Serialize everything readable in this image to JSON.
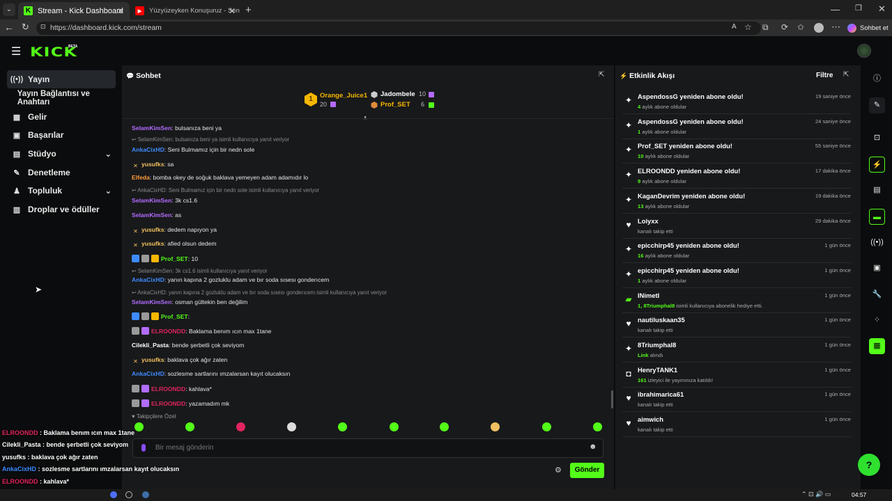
{
  "browser": {
    "tabs": [
      {
        "title": "Stream - Kick Dashboard",
        "active": true
      },
      {
        "title": "Yüzyüzeyken Konuşuruz - Sen",
        "active": false
      }
    ],
    "url": "https://dashboard.kick.com/stream",
    "profile_label": "Sohbet et"
  },
  "header": {
    "logo": "KICK",
    "logo_tag": "BETA"
  },
  "sidebar": {
    "items": [
      {
        "label": "Yayın",
        "icon": "broadcast-icon",
        "active": true
      },
      {
        "label": "Yayın Bağlantısı ve Anahtarı",
        "icon": "",
        "sub": true
      },
      {
        "label": "Gelir",
        "icon": "revenue-icon"
      },
      {
        "label": "Başarılar",
        "icon": "achievements-icon"
      },
      {
        "label": "Stüdyo",
        "icon": "studio-icon",
        "chevron": true
      },
      {
        "label": "Denetleme",
        "icon": "moderation-icon"
      },
      {
        "label": "Topluluk",
        "icon": "community-icon",
        "chevron": true
      },
      {
        "label": "Droplar ve ödüller",
        "icon": "drops-icon"
      }
    ]
  },
  "chat": {
    "title": "Sohbet",
    "leaderboard": {
      "rank": "1",
      "first": {
        "name": "Orange_Juice1",
        "count": "20"
      },
      "second": {
        "name": "Jadombele",
        "count": "10"
      },
      "third": {
        "name": "Prof_SET",
        "count": "6"
      }
    },
    "messages": [
      {
        "user": "SelamKimSen",
        "text": ": bulsanıza beni ya",
        "color": "#b26cff"
      },
      {
        "reply": "SelamKimSen: bulsanıza beni ya isimli kullanıcıya yanıt veriyor"
      },
      {
        "user": "AnkaCixHD",
        "text": ": Seni Bulmamız için bir nedn sole",
        "color": "#3d8bff"
      },
      {
        "user": "yusufks",
        "text": ": sa",
        "color": "#f0c060",
        "badge": "swords"
      },
      {
        "user": "Elfeda",
        "text": ": bomba okey de soğuk baklava yemeyen adam adamıdır lo",
        "color": "#ff9a3c"
      },
      {
        "reply": "AnkaCixHD: Seni Bulmamız için bir nedn sole isimli kullanıcıya yanıt veriyor"
      },
      {
        "user": "SelamKimSen",
        "text": ": 3k cs1.6",
        "color": "#b26cff"
      },
      {
        "user": "SelamKimSen",
        "text": ": as",
        "color": "#b26cff"
      },
      {
        "user": "yusufks",
        "text": ": dedem napıyon ya",
        "color": "#f0c060",
        "badge": "swords"
      },
      {
        "user": "yusufks",
        "text": ": afied olsun dedem",
        "color": "#f0c060",
        "badge": "swords"
      },
      {
        "user": "Prof_SET",
        "text": ": 10",
        "color": "#53fc18",
        "badge": "multi"
      },
      {
        "reply": "SelamKimSen: 3k cs1.6 isimli kullanıcıya yanıt veriyor"
      },
      {
        "user": "AnkaCixHD",
        "text": ": yanın kapına 2 gozluklu adam ve bır soda sısesı gonderıcem",
        "color": "#3d8bff"
      },
      {
        "reply": "AnkaCixHD: yanın kapına 2 gozluklu adam ve bır soda sısesı gonderıcem isimli kullanıcıya yanıt veriyor"
      },
      {
        "user": "SelamKimSen",
        "text": ": osman gültekin ben değilim",
        "color": "#b26cff"
      },
      {
        "user": "Prof_SET",
        "text": ":",
        "color": "#53fc18",
        "badge": "multi"
      },
      {
        "user": "ELROONDD",
        "text": ": Baklama benım ıcın max 1tane",
        "color": "#e0245e",
        "badge": "sub"
      },
      {
        "user": "Cilekli_Pasta",
        "text": ": bende şerbetli çok seviyom",
        "color": "#ffffff"
      },
      {
        "user": "yusufks",
        "text": ": baklava çok ağır zaten",
        "color": "#f0c060",
        "badge": "swords"
      },
      {
        "user": "AnkaCixHD",
        "text": ": sozlesme sartlarını ımzalarsan kayıt olucaksın",
        "color": "#3d8bff"
      },
      {
        "user": "ELROONDD",
        "text": ": kahlava*",
        "color": "#e0245e",
        "badge": "sub"
      },
      {
        "user": "ELROONDD",
        "text": ": yazamadım mk",
        "color": "#e0245e",
        "badge": "sub"
      }
    ],
    "followers_only": "Takipçilere Özel",
    "input_placeholder": "Bir mesaj gönderin",
    "send_label": "Gönder"
  },
  "activity": {
    "title": "Etkinlik Akışı",
    "filter_label": "Filtre",
    "items": [
      {
        "icon": "sparkle-icon",
        "title": "AspendossG yeniden abone oldu!",
        "num": "4",
        "sub": " aylık abone oldular",
        "time": "19 saniye önce"
      },
      {
        "icon": "sparkle-icon",
        "title": "AspendossG yeniden abone oldu!",
        "num": "1",
        "sub": " aylık abone oldular",
        "time": "24 saniye önce"
      },
      {
        "icon": "sparkle-icon",
        "title": "Prof_SET yeniden abone oldu!",
        "num": "10",
        "sub": " aylık abone oldular",
        "time": "55 saniye önce"
      },
      {
        "icon": "sparkle-icon",
        "title": "ELROONDD yeniden abone oldu!",
        "num": "9",
        "sub": " aylık abone oldular",
        "time": "17 dakika önce"
      },
      {
        "icon": "sparkle-icon",
        "title": "KaganDevrim yeniden abone oldu!",
        "num": "13",
        "sub": " aylık abone oldular",
        "time": "19 dakika önce"
      },
      {
        "icon": "heart-icon",
        "title": "Loiyxx",
        "num": "",
        "sub": "kanalı takip etti",
        "time": "29 dakika önce"
      },
      {
        "icon": "sparkle-icon",
        "title": "epicchirp45 yeniden abone oldu!",
        "num": "16",
        "sub": " aylık abone oldular",
        "time": "1 gün önce"
      },
      {
        "icon": "sparkle-icon",
        "title": "epicchirp45 yeniden abone oldu!",
        "num": "1",
        "sub": " aylık abone oldular",
        "time": "1 gün önce"
      },
      {
        "icon": "gift-icon",
        "title": "INimetI",
        "num": "1, 8Triumphal8",
        "sub": " isimli kullanıcıya abonelik hediye etti.",
        "time": "1 gün önce"
      },
      {
        "icon": "heart-icon",
        "title": "nautiluskaan35",
        "num": "",
        "sub": "kanalı takip etti",
        "time": "1 gün önce"
      },
      {
        "icon": "sparkle-icon",
        "title": "8Triumphal8",
        "num": "Link",
        "sub": " alındı",
        "time": "1 gün önce"
      },
      {
        "icon": "host-icon",
        "title": "HenryTANK1",
        "num": "161",
        "sub": " izleyici ile yayınınıza katıldı!",
        "time": "1 gün önce"
      },
      {
        "icon": "heart-icon",
        "title": "ibrahimarica61",
        "num": "",
        "sub": "kanalı takip etti",
        "time": "1 gün önce"
      },
      {
        "icon": "heart-icon",
        "title": "aimwich",
        "num": "",
        "sub": "kanalı takip etti",
        "time": "1 gün önce"
      }
    ]
  },
  "overlay_chat": [
    {
      "user": "ELROONDD",
      "text": " : Baklama benım ıcın max 1tane",
      "color": "#e0245e"
    },
    {
      "user": "Cilekli_Pasta",
      "text": " : bende şerbetli çok seviyom",
      "color": "#ffffff"
    },
    {
      "user": "yusufks",
      "text": " : baklava çok ağır zaten",
      "color": "#ffffff"
    },
    {
      "user": "AnkaCixHD",
      "text": " : sozlesme sartlarını ımzalarsan kayıt olucaksın",
      "color": "#3d8bff"
    },
    {
      "user": "ELROONDD",
      "text": " : kahlava*",
      "color": "#e0245e"
    },
    {
      "user": "ELROONDD",
      "text": " : yazamadım mk",
      "color": "#e0245e"
    }
  ],
  "taskbar": {
    "time": "04:57"
  },
  "colors": {
    "accent": "#53fc18",
    "panel": "#18191b",
    "background": "#0b0c0d"
  }
}
